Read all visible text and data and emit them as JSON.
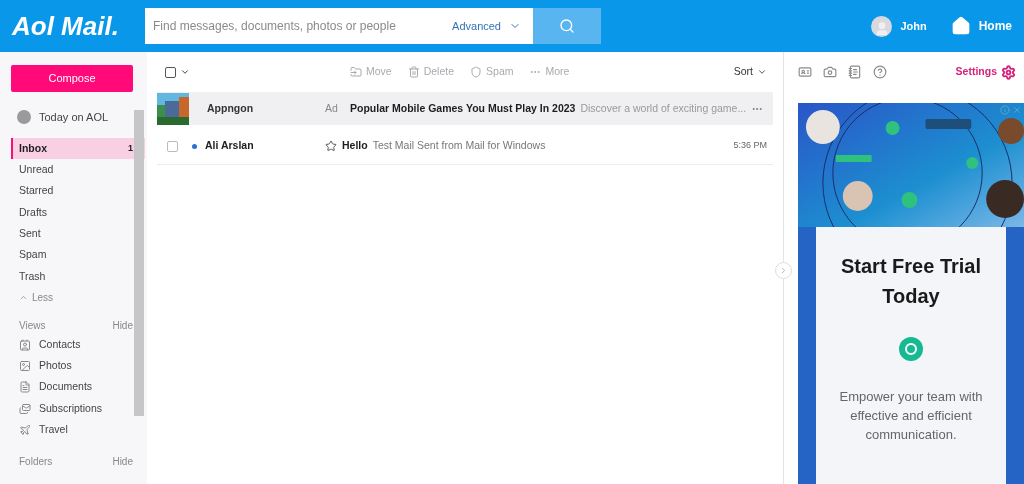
{
  "header": {
    "logo": "Aol Mail.",
    "search": {
      "placeholder": "Find messages, documents, photos or people",
      "advanced": "Advanced"
    },
    "user": "John",
    "home": "Home"
  },
  "sidebar": {
    "compose": "Compose",
    "today": "Today on AOL",
    "folders": [
      {
        "label": "Inbox",
        "count": "1",
        "selected": true
      },
      {
        "label": "Unread",
        "selected": false
      },
      {
        "label": "Starred",
        "selected": false
      },
      {
        "label": "Drafts",
        "selected": false
      },
      {
        "label": "Sent",
        "selected": false
      },
      {
        "label": "Spam",
        "selected": false
      },
      {
        "label": "Trash",
        "selected": false
      }
    ],
    "less": "Less",
    "views": {
      "title": "Views",
      "hide": "Hide",
      "items": [
        {
          "label": "Contacts"
        },
        {
          "label": "Photos"
        },
        {
          "label": "Documents"
        },
        {
          "label": "Subscriptions"
        },
        {
          "label": "Travel"
        }
      ]
    },
    "folders_section": {
      "title": "Folders",
      "hide": "Hide"
    }
  },
  "toolbar": {
    "select_all_checked": false,
    "actions": [
      {
        "label": "Move",
        "disabled": true
      },
      {
        "label": "Delete",
        "disabled": true
      },
      {
        "label": "Spam",
        "disabled": true
      },
      {
        "label": "More",
        "disabled": true
      }
    ],
    "sort": "Sort"
  },
  "messages": [
    {
      "kind": "ad",
      "sender": "Appngon",
      "tag": "Ad",
      "subject": "Popular Mobile Games You Must Play In 2023",
      "preview": "Discover a world of exciting game..."
    },
    {
      "kind": "mail",
      "sender": "Ali Arslan",
      "checked": false,
      "unread": true,
      "starred": false,
      "subject": "Hello",
      "preview": "Test Mail Sent from Mail for Windows",
      "time": "5:36 PM"
    }
  ],
  "right_panel": {
    "settings": "Settings",
    "ad": {
      "headline": "Start Free Trial Today",
      "body": "Empower your team with effective and efficient communication."
    }
  }
}
